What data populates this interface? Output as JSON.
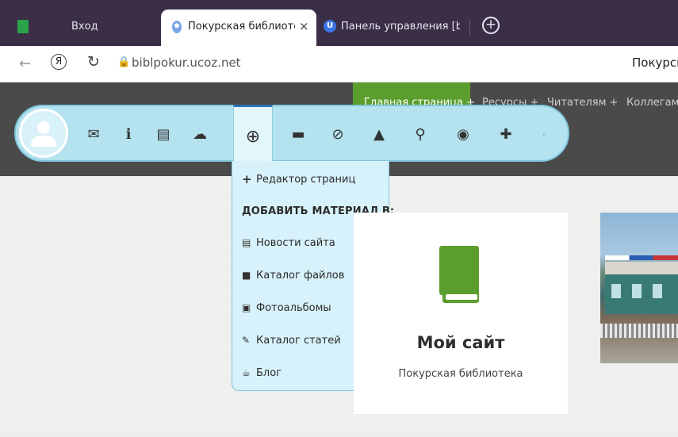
{
  "tabs": [
    {
      "label": "Вход"
    },
    {
      "label": "Покурская библиотека",
      "close": "×"
    },
    {
      "label": "Панель управления [biblp",
      "favicon_letter": "U"
    }
  ],
  "new_tab": "+",
  "address_bar": {
    "url": "biblpokur.ucoz.net",
    "yandex_letter": "Я",
    "page_title_right": "Покурск"
  },
  "site_menu": {
    "items": [
      "Главная страница +",
      "Ресурсы +",
      "Читателям +",
      "Коллегам"
    ],
    "active_color": "#5c9e2d"
  },
  "ucoz_panel": {
    "icons": [
      "mail-icon",
      "info-icon",
      "page-icon",
      "chat-icon",
      "add-icon",
      "folder-icon",
      "block-icon",
      "bell-icon",
      "search-icon",
      "eye-icon",
      "puzzle-icon",
      "chevron-left-icon"
    ],
    "accent": "#2e6fb8"
  },
  "dropdown": {
    "editor": "Редактор страниц",
    "heading": "ДОБАВИТЬ МАТЕРИАЛ В:",
    "items": [
      {
        "label": "Новости сайта",
        "icon": "news-icon"
      },
      {
        "label": "Каталог файлов",
        "icon": "folder-icon"
      },
      {
        "label": "Фотоальбомы",
        "icon": "photo-icon"
      },
      {
        "label": "Каталог статей",
        "icon": "edit-icon"
      },
      {
        "label": "Блог",
        "icon": "cup-icon"
      }
    ]
  },
  "card": {
    "title": "Мой сайт",
    "subtitle": "Покурская библиотека",
    "icon_color": "#5c9e2d"
  }
}
